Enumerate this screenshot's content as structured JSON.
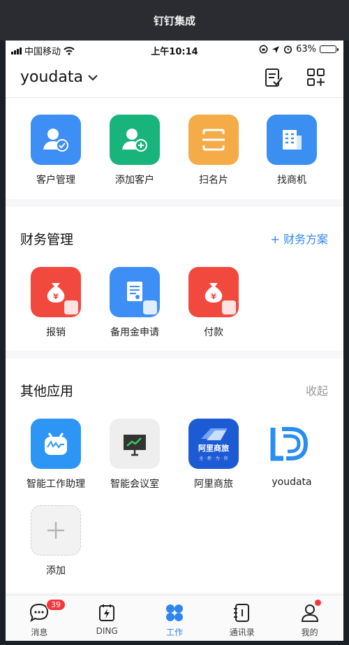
{
  "window_title": "钉钉集成",
  "status": {
    "carrier": "中国移动",
    "time": "上午10:14",
    "battery": "63%",
    "battery_level": 0.63
  },
  "header": {
    "org_name": "youdata"
  },
  "crm": {
    "apps": [
      {
        "label": "客户管理",
        "color": "#3d8ef5"
      },
      {
        "label": "添加客户",
        "color": "#19b37c"
      },
      {
        "label": "扫名片",
        "color": "#f5ab47"
      },
      {
        "label": "找商机",
        "color": "#3b8ff0"
      }
    ]
  },
  "finance": {
    "title": "财务管理",
    "action": "+ 财务方案",
    "apps": [
      {
        "label": "报销",
        "color": "#f1493d"
      },
      {
        "label": "备用金申请",
        "color": "#3d8ef5"
      },
      {
        "label": "付款",
        "color": "#f1493d"
      }
    ]
  },
  "other": {
    "title": "其他应用",
    "action": "收起",
    "apps": [
      {
        "label": "智能工作助理",
        "color": "#2d96f5"
      },
      {
        "label": "智能会议室",
        "color": "#eeeeee"
      },
      {
        "label": "阿里商旅",
        "color": "#1d5bd4",
        "icon_text": "阿里商旅",
        "icon_subtext": "全 · 新 · 为 · 你"
      },
      {
        "label": "youdata",
        "color": "#ffffff"
      },
      {
        "label": "添加",
        "color": "#f2f2f2"
      }
    ]
  },
  "tabbar": {
    "items": [
      {
        "label": "消息",
        "badge": "39"
      },
      {
        "label": "DING"
      },
      {
        "label": "工作"
      },
      {
        "label": "通讯录"
      },
      {
        "label": "我的"
      }
    ]
  },
  "colors": {
    "accent": "#2e86f0",
    "badge": "#f5363a"
  }
}
